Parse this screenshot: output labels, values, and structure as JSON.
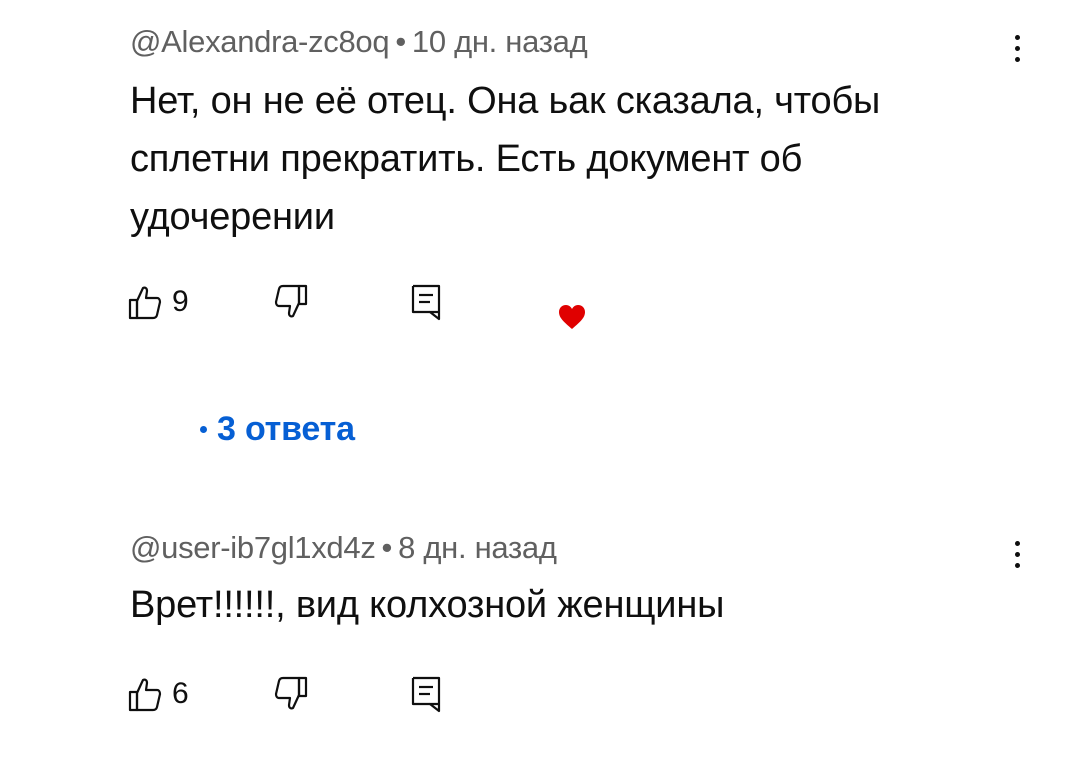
{
  "comments": [
    {
      "author": "@Alexandra-zc8oq",
      "separator": "•",
      "time": "10 дн. назад",
      "text": "Нет, он не её отец. Она ьак сказала, чтобы сплетни прекратить. Есть документ об удочерении",
      "likes": "9",
      "creator_heart": true,
      "replies_label": "3 ответа"
    },
    {
      "author": "@user-ib7gl1xd4z",
      "separator": "•",
      "time": "8 дн. назад",
      "text": "Врет!!!!!!, вид колхозной женщины",
      "likes": "6"
    }
  ],
  "icons": {
    "like": "thumbs-up-icon",
    "dislike": "thumbs-down-icon",
    "reply": "reply-comment-icon",
    "more": "more-vertical-icon",
    "heart": "creator-heart-icon"
  },
  "colors": {
    "text": "#0f0f0f",
    "meta": "#606060",
    "link": "#065fd4",
    "heart": "#e00000"
  }
}
